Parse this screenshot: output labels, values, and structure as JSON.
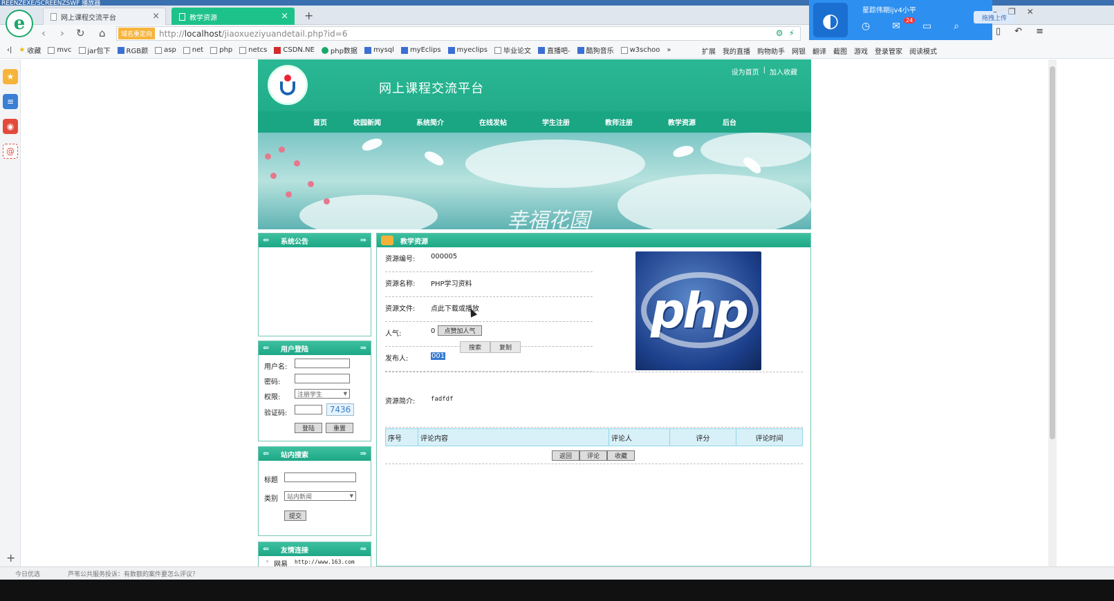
{
  "window": {
    "title_fragment": "REENZEXE/SCREENZSWF 播放器"
  },
  "tabs": [
    {
      "label": "网上课程交流平台",
      "active": false
    },
    {
      "label": "教学资源",
      "active": true
    }
  ],
  "address": {
    "redirect_badge": "域名重定向",
    "url_prefix": "http://",
    "url_host": "localhost",
    "url_path": "/jiaoxueziyuandetail.php?id=6"
  },
  "bookmarks": [
    "收藏",
    "mvc",
    "jar包下",
    "RGB颜",
    "asp",
    "net",
    "php",
    "netcs",
    "CSDN.NE",
    "php数据",
    "mysql",
    "myEclips",
    "myeclips",
    "毕业论文",
    "直播吧-",
    "酷狗音乐",
    "w3schoo"
  ],
  "bookmarks_right": [
    "扩展",
    "我的直播",
    "购物助手",
    "网银",
    "翻译",
    "截图",
    "游戏",
    "登录管家",
    "阅读模式"
  ],
  "qq": {
    "name": "星踪伟期ijv4小平",
    "upload": "拖拽上传",
    "badge": "24"
  },
  "site": {
    "title": "网上课程交流平台",
    "toplinks": [
      "设为首页",
      "|",
      "加入收藏"
    ],
    "nav": [
      "首页",
      "校园新闻",
      "系统简介",
      "在线发帖",
      "学生注册",
      "教师注册",
      "教学资源",
      "后台"
    ],
    "banner_text": "幸福花園"
  },
  "sidebar": {
    "notice_title": "系统公告",
    "login_title": "用户登陆",
    "username_label": "用户名:",
    "password_label": "密码:",
    "role_label": "权限:",
    "role_value": "注册学生",
    "captcha_label": "验证码:",
    "captcha_code": "7436",
    "login_btn": "登陆",
    "reset_btn": "重置",
    "search_title": "站内搜索",
    "search_title_label": "标题",
    "search_cat_label": "类别",
    "search_cat_value": "站内新闻",
    "submit_btn": "提交",
    "links_title": "友情连接",
    "link_name": "网易",
    "link_url": "http://www.163.com"
  },
  "detail": {
    "header": "教学资源",
    "id_label": "资源编号:",
    "id_value": "000005",
    "name_label": "资源名称:",
    "name_value": "PHP学习资料",
    "file_label": "资源文件:",
    "file_value": "点此下载或播放",
    "pop_label": "人气:",
    "pop_value": "0",
    "pop_btn": "点赞加人气",
    "search_btn": "搜索",
    "copy_btn": "复制",
    "publisher_label": "发布人:",
    "publisher_value": "001",
    "intro_label": "资源简介:",
    "intro_value": "fadfdf",
    "image_text": "php",
    "table_headers": [
      "序号",
      "评论内容",
      "评论人",
      "评分",
      "评论时间"
    ],
    "back_btn": "返回",
    "comment_btn": "评论",
    "fav_btn": "收藏"
  },
  "status": {
    "left": "今日优选",
    "msg": "芦苇公共服务投诉：有数额的案件要怎么评议？"
  },
  "colors": {
    "accent": "#1fa886",
    "tab_active": "#1dc28a"
  }
}
